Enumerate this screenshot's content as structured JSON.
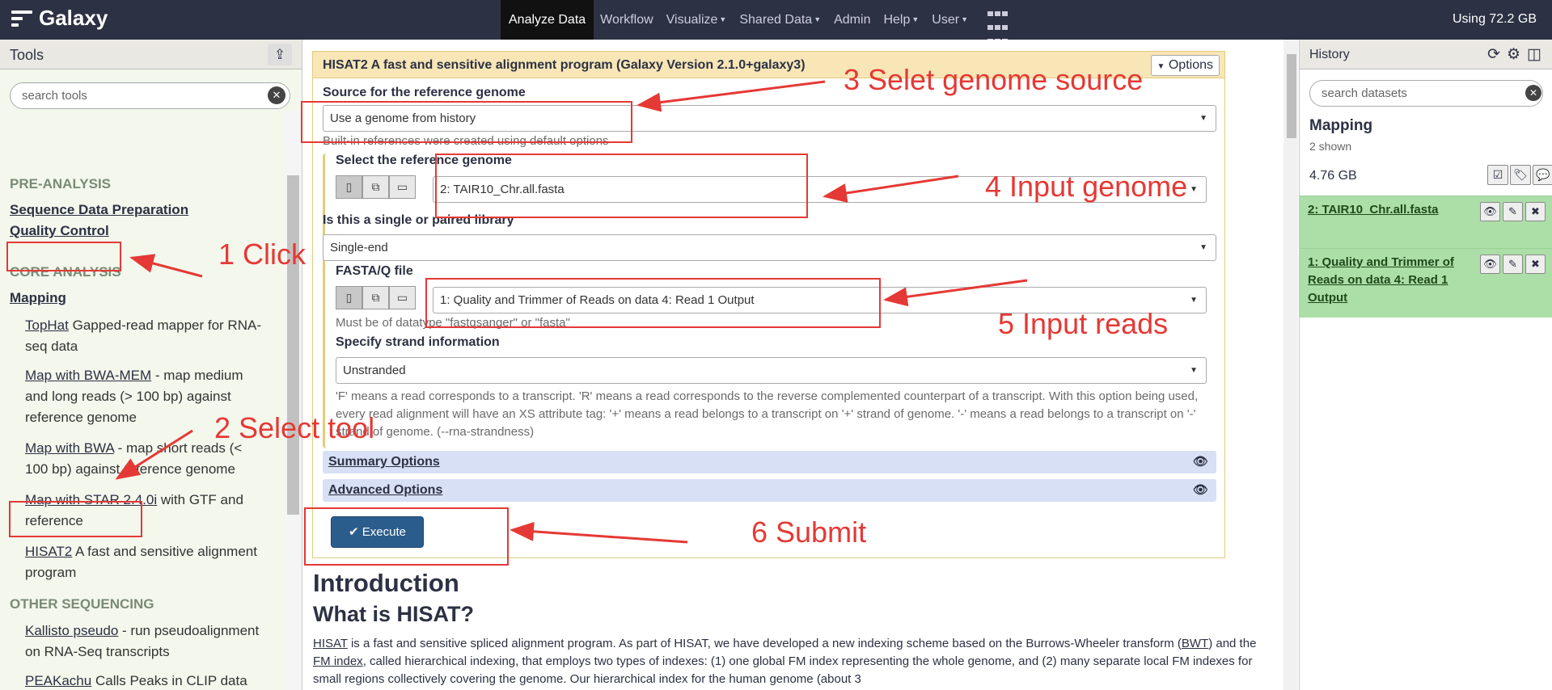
{
  "masthead": {
    "brand": "Galaxy",
    "nav": [
      "Analyze Data",
      "Workflow",
      "Visualize",
      "Shared Data",
      "Admin",
      "Help",
      "User"
    ],
    "quota": "Using 72.2 GB"
  },
  "tools_panel": {
    "title": "Tools",
    "search_placeholder": "search tools",
    "sections": [
      "PRE-ANALYSIS",
      "CORE ANALYSIS",
      "OTHER SEQUENCING"
    ],
    "categories": [
      "Sequence Data Preparation",
      "Quality Control",
      "Mapping"
    ],
    "tools": [
      {
        "name": "TopHat",
        "desc": " Gapped-read mapper for RNA-seq data"
      },
      {
        "name": "Map with BWA-MEM",
        "desc": " - map medium and long reads (> 100 bp) against reference genome"
      },
      {
        "name": "Map with BWA",
        "desc": " - map short reads (< 100 bp) against reference genome"
      },
      {
        "name": "Map with STAR 2.4.0i",
        "desc": " with GTF and reference"
      },
      {
        "name": "HISAT2",
        "desc": " A fast and sensitive alignment program"
      },
      {
        "name": "Kallisto pseudo",
        "desc": " - run pseudoalignment on RNA-Seq transcripts"
      },
      {
        "name": "PEAKachu",
        "desc": " Calls Peaks in CLIP data"
      }
    ]
  },
  "form": {
    "title": "HISAT2 A fast and sensitive alignment program (Galaxy Version 2.1.0+galaxy3)",
    "options_label": "Options",
    "source_label": "Source for the reference genome",
    "source_value": "Use a genome from history",
    "source_help": "Built-in references were created using default options",
    "ref_label": "Select the reference genome",
    "ref_value": "2: TAIR10_Chr.all.fasta",
    "lib_label": "Is this a single or paired library",
    "lib_value": "Single-end",
    "fastq_label": "FASTA/Q file",
    "fastq_value": "1: Quality and Trimmer of Reads on data 4: Read 1 Output",
    "fastq_help": "Must be of datatype \"fastqsanger\" or \"fasta\"",
    "strand_label": "Specify strand information",
    "strand_value": "Unstranded",
    "strand_help": "'F' means a read corresponds to a transcript. 'R' means a read corresponds to the reverse complemented counterpart of a transcript. With this option being used, every read alignment will have an XS attribute tag: '+' means a read belongs to a transcript on '+' strand of genome. '-' means a read belongs to a transcript on '-' strand of genome. (--rna-strandness)",
    "summary_label": "Summary Options",
    "advanced_label": "Advanced Options",
    "execute_label": "Execute"
  },
  "intro": {
    "h1": "Introduction",
    "h2": "What is HISAT?",
    "p1": "HISAT",
    "p2": " is a fast and sensitive spliced alignment program. As part of HISAT, we have developed a new indexing scheme based on the Burrows-Wheeler transform (",
    "p3": "BWT",
    "p4": ") and the ",
    "p5": "FM index",
    "p6": ", called hierarchical indexing, that employs two types of indexes: (1) one global FM index representing the whole genome, and (2) many separate local FM indexes for small regions collectively covering the genome. Our hierarchical index for the human genome (about 3"
  },
  "history": {
    "title": "History",
    "search_placeholder": "search datasets",
    "name": "Mapping",
    "shown": "2 shown",
    "size": "4.76 GB",
    "datasets": [
      {
        "title": "2: TAIR10_Chr.all.fasta"
      },
      {
        "title": "1: Quality and Trimmer of Reads on data 4: Read 1 Output"
      }
    ]
  },
  "annotations": [
    "1 Click",
    "2 Select tool",
    "3 Selet genome source",
    "4 Input genome",
    "5 Input reads",
    "6 Submit"
  ]
}
